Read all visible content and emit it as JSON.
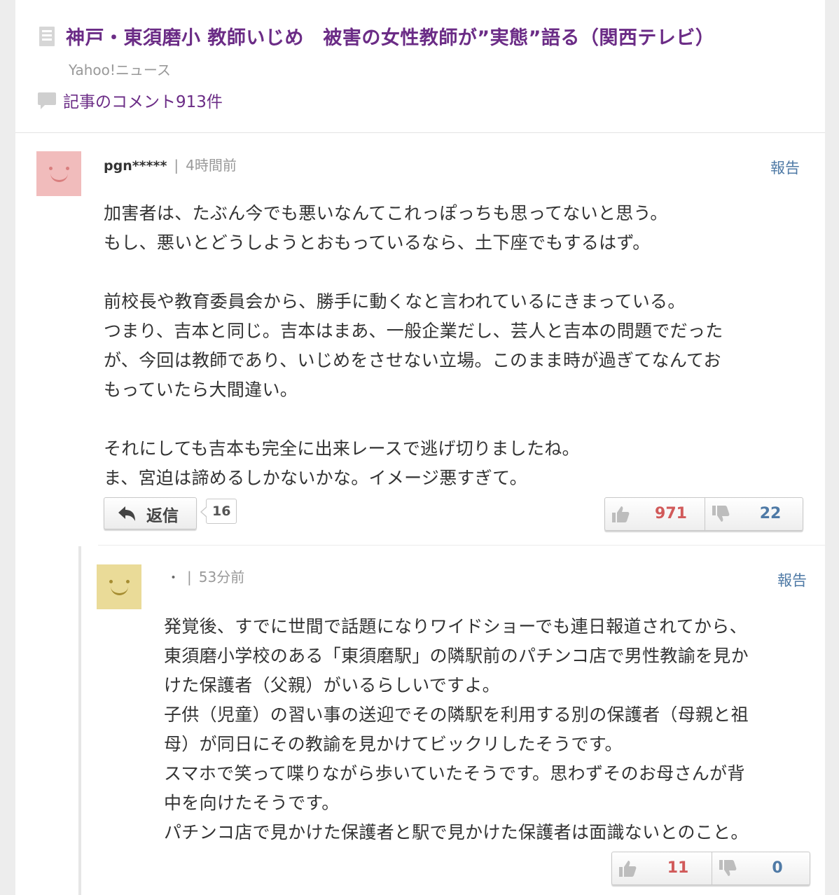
{
  "article": {
    "title": "神戸・東須磨小 教師いじめ　被害の女性教師が”実態”語る（関西テレビ）",
    "source": "Yahoo!ニュース",
    "comment_count": "記事のコメント913件"
  },
  "comment": {
    "user": "pgn*****",
    "separator": "|",
    "time": "4時間前",
    "report": "報告",
    "lines": [
      "加害者は、たぶん今でも悪いなんてこれっぽっちも思ってないと思う。",
      "もし、悪いとどうしようとおもっているなら、土下座でもするはず。",
      "",
      "前校長や教育委員会から、勝手に動くなと言われているにきまっている。",
      "つまり、吉本と同じ。吉本はまあ、一般企業だし、芸人と吉本の問題でだった",
      "が、今回は教師であり、いじめをさせない立場。このまま時が過ぎてなんてお",
      "もっていたら大間違い。",
      "",
      "それにしても吉本も完全に出来レースで逃げ切りましたね。",
      "ま、宮迫は諦めるしかないかな。イメージ悪すぎて。"
    ],
    "reply_label": "返信",
    "reply_count": "16",
    "likes": "971",
    "dislikes": "22"
  },
  "reply": {
    "user": "・",
    "separator": "|",
    "time": "53分前",
    "report": "報告",
    "lines": [
      "発覚後、すでに世間で話題になりワイドショーでも連日報道されてから、",
      "東須磨小学校のある「東須磨駅」の隣駅前のパチンコ店で男性教諭を見か",
      "けた保護者（父親）がいるらしいですよ。",
      "子供（児童）の習い事の送迎でその隣駅を利用する別の保護者（母親と祖",
      "母）が同日にその教諭を見かけてビックリしたそうです。",
      "スマホで笑って喋りながら歩いていたそうです。思わずそのお母さんが背",
      "中を向けたそうです。",
      "パチンコ店で見かけた保護者と駅で見かけた保護者は面識ないとのこと。"
    ],
    "likes": "11",
    "dislikes": "0"
  },
  "colors": {
    "title": "#6b2c86",
    "link": "#4f7aa6",
    "like": "#d15a5a",
    "dislike": "#4f7aa6",
    "avatar_pink": "#f1bcbc",
    "avatar_yellow": "#eadb98"
  },
  "icons": [
    "document-icon",
    "comment-bubble-icon",
    "reply-arrow-icon",
    "thumbs-up-icon",
    "thumbs-down-icon"
  ]
}
